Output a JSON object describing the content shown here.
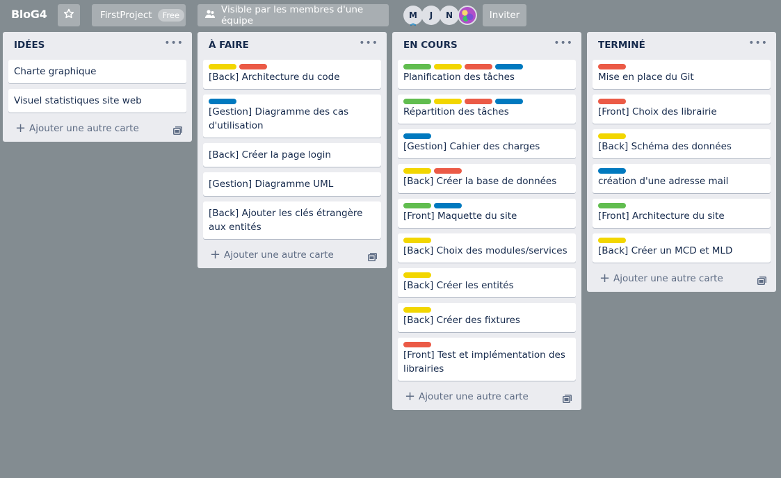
{
  "header": {
    "board_title": "BloG4",
    "project_name": "FirstProject",
    "plan_badge": "Free",
    "visibility": "Visible par les membres d'une équipe",
    "members": [
      "M",
      "J",
      "N"
    ],
    "invite_label": "Inviter"
  },
  "colors": {
    "green": "#61bd4f",
    "yellow": "#f2d600",
    "red": "#eb5a46",
    "blue": "#0079bf"
  },
  "add_card_label": "Ajouter une autre carte",
  "lists": [
    {
      "title": "IDÉES",
      "cards": [
        {
          "labels": [],
          "title": "Charte graphique"
        },
        {
          "labels": [],
          "title": "Visuel statistiques site web"
        }
      ]
    },
    {
      "title": "À FAIRE",
      "cards": [
        {
          "labels": [
            "yellow",
            "red"
          ],
          "title": "[Back] Architecture du code"
        },
        {
          "labels": [
            "blue"
          ],
          "title": "[Gestion] Diagramme des cas d'utilisation"
        },
        {
          "labels": [],
          "title": "[Back] Créer la page login"
        },
        {
          "labels": [],
          "title": "[Gestion] Diagramme UML"
        },
        {
          "labels": [],
          "title": "[Back] Ajouter les clés étrangère aux entités"
        }
      ]
    },
    {
      "title": "EN COURS",
      "cards": [
        {
          "labels": [
            "green",
            "yellow",
            "red",
            "blue"
          ],
          "title": "Planification des tâches"
        },
        {
          "labels": [
            "green",
            "yellow",
            "red",
            "blue"
          ],
          "title": "Répartition des tâches"
        },
        {
          "labels": [
            "blue"
          ],
          "title": "[Gestion] Cahier des charges"
        },
        {
          "labels": [
            "yellow",
            "red"
          ],
          "title": "[Back] Créer la base de données"
        },
        {
          "labels": [
            "green",
            "blue"
          ],
          "title": "[Front] Maquette du site"
        },
        {
          "labels": [
            "yellow"
          ],
          "title": "[Back] Choix des modules/services"
        },
        {
          "labels": [
            "yellow"
          ],
          "title": "[Back] Créer les entités"
        },
        {
          "labels": [
            "yellow"
          ],
          "title": "[Back] Créer des fixtures"
        },
        {
          "labels": [
            "red"
          ],
          "title": "[Front] Test et implémentation des librairies"
        }
      ]
    },
    {
      "title": "TERMINÉ",
      "cards": [
        {
          "labels": [
            "red"
          ],
          "title": "Mise en place du Git"
        },
        {
          "labels": [
            "red"
          ],
          "title": "[Front] Choix des librairie"
        },
        {
          "labels": [
            "yellow"
          ],
          "title": "[Back] Schéma des données"
        },
        {
          "labels": [
            "blue"
          ],
          "title": "création d'une adresse mail"
        },
        {
          "labels": [
            "green"
          ],
          "title": "[Front] Architecture du site"
        },
        {
          "labels": [
            "yellow"
          ],
          "title": "[Back] Créer un MCD et MLD"
        }
      ]
    }
  ]
}
